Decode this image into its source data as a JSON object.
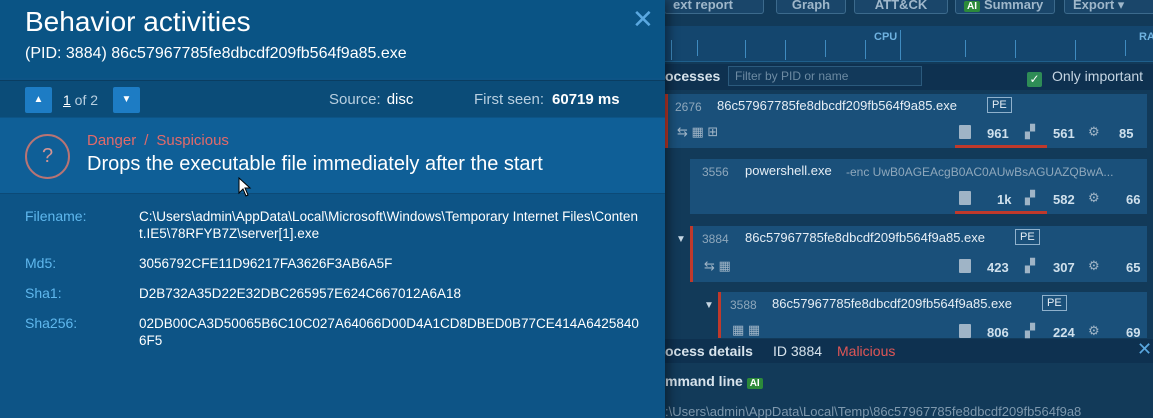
{
  "background": {
    "top_buttons": [
      "ext report",
      "Graph",
      "ATT&CK",
      "Summary",
      "Export"
    ],
    "summary_badge": "AI",
    "cpu_label": "CPU",
    "ram_label": "RA",
    "processes_title": "ocesses",
    "pid_filter_placeholder": "Filter by PID or name",
    "only_important": "Only important",
    "processes": [
      {
        "pid": "2676",
        "name": "86c57967785fe8dbcdf209fb564f9a85.exe",
        "badge": "PE",
        "args": "",
        "stats": [
          "961",
          "561",
          "85"
        ]
      },
      {
        "pid": "3556",
        "name": "powershell.exe",
        "badge": "",
        "args": "-enc UwB0AGEAcgB0AC0AUwBsAGUAZQBwA...",
        "stats": [
          "1k",
          "582",
          "66"
        ]
      },
      {
        "pid": "3884",
        "name": "86c57967785fe8dbcdf209fb564f9a85.exe",
        "badge": "PE",
        "args": "",
        "stats": [
          "423",
          "307",
          "65"
        ]
      },
      {
        "pid": "3588",
        "name": "86c57967785fe8dbcdf209fb564f9a85.exe",
        "badge": "PE",
        "args": "",
        "stats": [
          "806",
          "224",
          "69"
        ]
      }
    ],
    "details": {
      "title": "ocess details",
      "id": "ID 3884",
      "verdict": "Malicious"
    },
    "cmdline_label": "mmand line",
    "cmdline_badge": "AI",
    "cmdline_value": ":\\Users\\admin\\AppData\\Local\\Temp\\86c57967785fe8dbcdf209fb564f9a8"
  },
  "modal": {
    "title": "Behavior activities",
    "subtitle": "(PID: 3884) 86c57967785fe8dbcdf209fb564f9a85.exe",
    "pager": {
      "current": "1",
      "of_text": " of 2"
    },
    "source_label": "Source:",
    "source_value": "disc",
    "first_seen_label": "First seen:",
    "first_seen_value": "60719 ms",
    "alert": {
      "icon": "?",
      "level": "Danger",
      "separator": "/",
      "category": "Suspicious",
      "text": "Drops the executable file immediately after the start"
    },
    "info": [
      {
        "label": "Filename:",
        "value": "C:\\Users\\admin\\AppData\\Local\\Microsoft\\Windows\\Temporary Internet Files\\Content.IE5\\78RFYB7Z\\server[1].exe"
      },
      {
        "label": "Md5:",
        "value": "3056792CFE11D96217FA3626F3AB6A5F"
      },
      {
        "label": "Sha1:",
        "value": "D2B732A35D22E32DBC265957E624C667012A6A18"
      },
      {
        "label": "Sha256:",
        "value": "02DB00CA3D50065B6C10C027A64066D00D4A1CD8DBED0B77CE414A64258406F5"
      }
    ]
  },
  "colors": {
    "accent": "#1d7cc4",
    "danger": "#e26a6a",
    "label": "#5fb8ee"
  }
}
